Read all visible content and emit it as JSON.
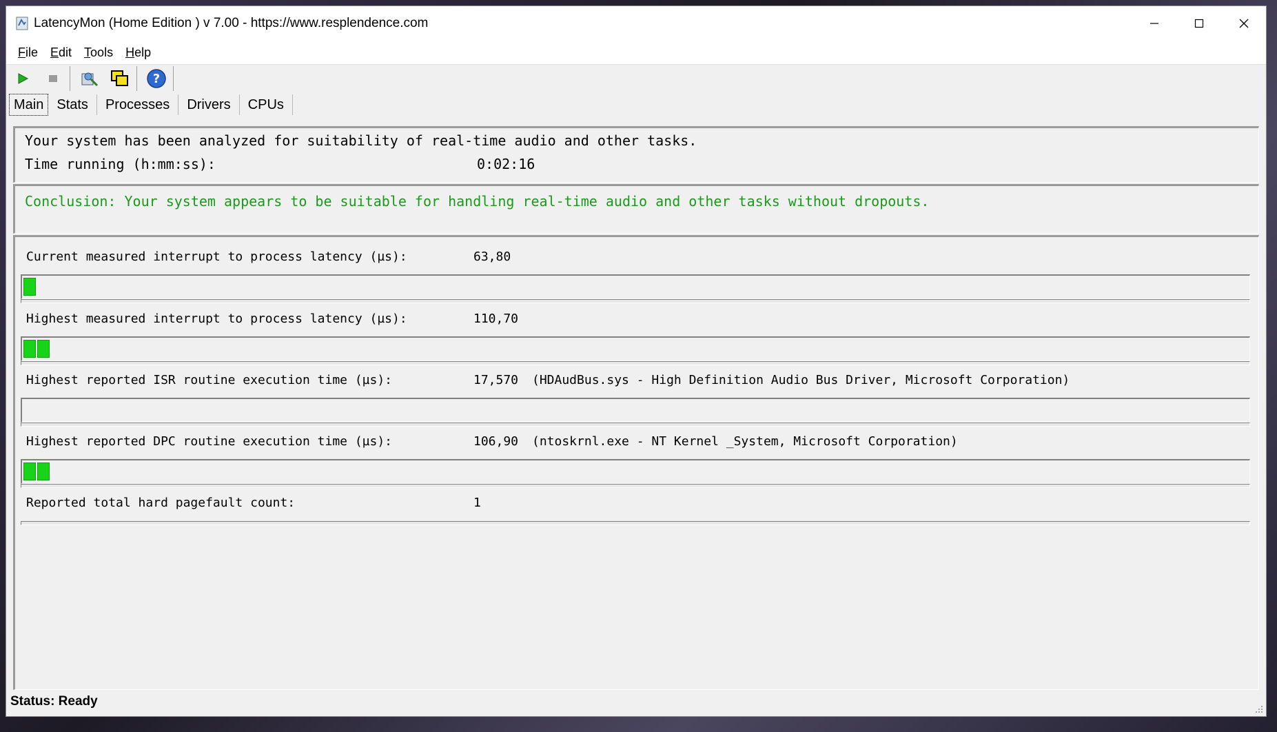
{
  "window": {
    "title": "LatencyMon  (Home Edition )  v 7.00 - https://www.resplendence.com",
    "controls": {
      "minimize": "minimize-icon",
      "maximize": "maximize-icon",
      "close": "close-icon"
    }
  },
  "menu": [
    "File",
    "Edit",
    "Tools",
    "Help"
  ],
  "toolbar": {
    "buttons": [
      "play-icon",
      "stop-icon",
      "analyze-icon",
      "window-icon",
      "help-icon"
    ]
  },
  "tabs": [
    "Main",
    "Stats",
    "Processes",
    "Drivers",
    "CPUs"
  ],
  "active_tab": "Main",
  "info": {
    "analyzed_text": "Your system has been analyzed for suitability of real-time audio and other tasks.",
    "time_label": "Time running (h:mm:ss):",
    "time_value": "0:02:16"
  },
  "conclusion": {
    "text": "Conclusion: Your system appears to be suitable for handling real-time audio and other tasks without dropouts.",
    "color": "#1a9a1a"
  },
  "metrics": [
    {
      "label": "Current measured interrupt to process latency (µs):",
      "value": "63,80",
      "detail": "",
      "bar_segments": 1
    },
    {
      "label": "Highest measured interrupt to process latency (µs):",
      "value": "110,70",
      "detail": "",
      "bar_segments": 2
    },
    {
      "label": "Highest reported ISR routine execution time (µs):",
      "value": "17,570",
      "detail": "(HDAudBus.sys - High Definition Audio Bus Driver, Microsoft Corporation)",
      "bar_segments": 0
    },
    {
      "label": "Highest reported DPC routine execution time (µs):",
      "value": "106,90",
      "detail": "(ntoskrnl.exe - NT Kernel _System, Microsoft Corporation)",
      "bar_segments": 2
    },
    {
      "label": "Reported total hard pagefault count:",
      "value": "1",
      "detail": "",
      "bar_segments": null
    }
  ],
  "bar_color": "#18d318",
  "status": {
    "text": "Status: Ready"
  }
}
